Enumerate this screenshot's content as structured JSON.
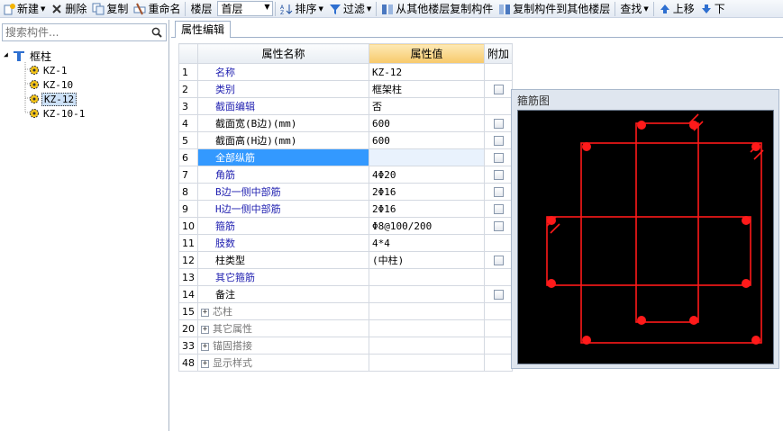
{
  "toolbar": {
    "new_label": "新建",
    "delete_label": "删除",
    "copy_label": "复制",
    "rename_label": "重命名",
    "floor_label": "楼层",
    "floor_value": "首层",
    "sort_label": "排序",
    "filter_label": "过滤",
    "copy_from_label": "从其他楼层复制构件",
    "copy_to_label": "复制构件到其他楼层",
    "find_label": "查找",
    "move_up_label": "上移",
    "move_down_label": "下"
  },
  "search": {
    "placeholder": "搜索构件..."
  },
  "tree": {
    "root": "框柱",
    "items": [
      {
        "label": "KZ-1"
      },
      {
        "label": "KZ-10"
      },
      {
        "label": "KZ-12",
        "selected": true
      },
      {
        "label": "KZ-10-1"
      }
    ]
  },
  "tab": {
    "label": "属性编辑"
  },
  "grid": {
    "headers": {
      "name": "属性名称",
      "value": "属性值",
      "extra": "附加"
    },
    "rows": [
      {
        "num": "1",
        "name": "名称",
        "value": "KZ-12"
      },
      {
        "num": "2",
        "name": "类别",
        "value": "框架柱"
      },
      {
        "num": "3",
        "name": "截面编辑",
        "value": "否"
      },
      {
        "num": "4",
        "name": "截面宽(B边)(mm)",
        "value": "600"
      },
      {
        "num": "5",
        "name": "截面高(H边)(mm)",
        "value": "600"
      },
      {
        "num": "6",
        "name": "全部纵筋",
        "value": ""
      },
      {
        "num": "7",
        "name": "角筋",
        "value": "4Φ20"
      },
      {
        "num": "8",
        "name": "B边一侧中部筋",
        "value": "2Φ16"
      },
      {
        "num": "9",
        "name": "H边一侧中部筋",
        "value": "2Φ16"
      },
      {
        "num": "10",
        "name": "箍筋",
        "value": "Φ8@100/200"
      },
      {
        "num": "11",
        "name": "肢数",
        "value": "4*4"
      },
      {
        "num": "12",
        "name": "柱类型",
        "value": "(中柱)"
      },
      {
        "num": "13",
        "name": "其它箍筋",
        "value": ""
      },
      {
        "num": "14",
        "name": "备注",
        "value": ""
      },
      {
        "num": "15",
        "name": "芯柱",
        "value": ""
      },
      {
        "num": "20",
        "name": "其它属性",
        "value": ""
      },
      {
        "num": "33",
        "name": "锚固搭接",
        "value": ""
      },
      {
        "num": "48",
        "name": "显示样式",
        "value": ""
      }
    ]
  },
  "preview": {
    "title": "箍筋图"
  },
  "colors": {
    "rebar": "#ff1a1a",
    "selection": "#3399ff",
    "header_highlight": "#f7c96a"
  }
}
